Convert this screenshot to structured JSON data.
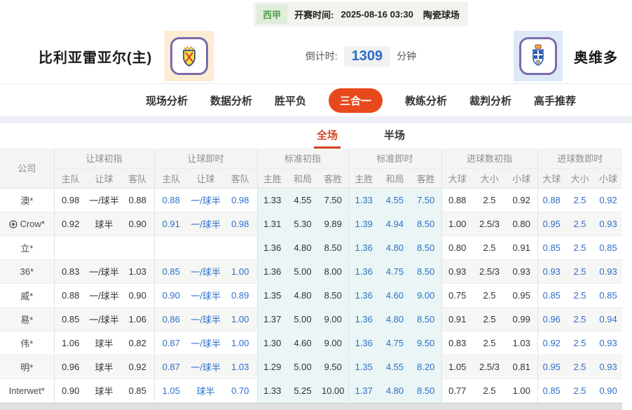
{
  "header": {
    "league": "西甲",
    "kickoff_label": "开赛时间:",
    "kickoff_time": "2025-08-16 03:30",
    "venue": "陶瓷球场",
    "home_team": "比利亚雷亚尔(主)",
    "away_team": "奥维多",
    "countdown_label": "倒计时:",
    "countdown_value": "1309",
    "countdown_unit": "分钟"
  },
  "colors": {
    "accent_red": "#e8491c",
    "tab_red": "#d8472a",
    "live_blue": "#2e6fc9",
    "cyan_column_bg": "#e9f6f5",
    "league_green": "#55a055"
  },
  "nav": {
    "items": [
      {
        "label": "现场分析",
        "active": false
      },
      {
        "label": "数据分析",
        "active": false
      },
      {
        "label": "胜平负",
        "active": false
      },
      {
        "label": "三合一",
        "active": true
      },
      {
        "label": "教练分析",
        "active": false
      },
      {
        "label": "裁判分析",
        "active": false
      },
      {
        "label": "高手推荐",
        "active": false
      }
    ]
  },
  "subtabs": [
    {
      "label": "全场",
      "active": true
    },
    {
      "label": "半场",
      "active": false
    }
  ],
  "table": {
    "company_header": "公司",
    "groups": [
      {
        "label": "让球初指",
        "cols": [
          "主队",
          "让球",
          "客队"
        ]
      },
      {
        "label": "让球即时",
        "cols": [
          "主队",
          "让球",
          "客队"
        ]
      },
      {
        "label": "标准初指",
        "cols": [
          "主胜",
          "和局",
          "客胜"
        ]
      },
      {
        "label": "标准即时",
        "cols": [
          "主胜",
          "和局",
          "客胜"
        ]
      },
      {
        "label": "进球数初指",
        "cols": [
          "大球",
          "大小",
          "小球"
        ]
      },
      {
        "label": "进球数即时",
        "cols": [
          "大球",
          "大小",
          "小球"
        ]
      }
    ],
    "rows": [
      {
        "company": "澳*",
        "icon": false,
        "handicap_initial": [
          "0.98",
          "一/球半",
          "0.88"
        ],
        "handicap_live": [
          "0.88",
          "一/球半",
          "0.98"
        ],
        "standard_initial": [
          "1.33",
          "4.55",
          "7.50"
        ],
        "standard_live": [
          "1.33",
          "4.55",
          "7.50"
        ],
        "goals_initial": [
          "0.88",
          "2.5",
          "0.92"
        ],
        "goals_live": [
          "0.88",
          "2.5",
          "0.92"
        ]
      },
      {
        "company": "Crow*",
        "icon": true,
        "handicap_initial": [
          "0.92",
          "球半",
          "0.90"
        ],
        "handicap_live": [
          "0.91",
          "一/球半",
          "0.98"
        ],
        "standard_initial": [
          "1.31",
          "5.30",
          "9.89"
        ],
        "standard_live": [
          "1.39",
          "4.94",
          "8.50"
        ],
        "goals_initial": [
          "1.00",
          "2.5/3",
          "0.80"
        ],
        "goals_live": [
          "0.95",
          "2.5",
          "0.93"
        ]
      },
      {
        "company": "立*",
        "icon": false,
        "handicap_initial": [
          "",
          "",
          ""
        ],
        "handicap_live": [
          "",
          "",
          ""
        ],
        "standard_initial": [
          "1.36",
          "4.80",
          "8.50"
        ],
        "standard_live": [
          "1.36",
          "4.80",
          "8.50"
        ],
        "goals_initial": [
          "0.80",
          "2.5",
          "0.91"
        ],
        "goals_live": [
          "0.85",
          "2.5",
          "0.85"
        ]
      },
      {
        "company": "36*",
        "icon": false,
        "handicap_initial": [
          "0.83",
          "一/球半",
          "1.03"
        ],
        "handicap_live": [
          "0.85",
          "一/球半",
          "1.00"
        ],
        "standard_initial": [
          "1.36",
          "5.00",
          "8.00"
        ],
        "standard_live": [
          "1.36",
          "4.75",
          "8.50"
        ],
        "goals_initial": [
          "0.93",
          "2.5/3",
          "0.93"
        ],
        "goals_live": [
          "0.93",
          "2.5",
          "0.93"
        ]
      },
      {
        "company": "威*",
        "icon": false,
        "handicap_initial": [
          "0.88",
          "一/球半",
          "0.90"
        ],
        "handicap_live": [
          "0.90",
          "一/球半",
          "0.89"
        ],
        "standard_initial": [
          "1.35",
          "4.80",
          "8.50"
        ],
        "standard_live": [
          "1.36",
          "4.60",
          "9.00"
        ],
        "goals_initial": [
          "0.75",
          "2.5",
          "0.95"
        ],
        "goals_live": [
          "0.85",
          "2.5",
          "0.85"
        ]
      },
      {
        "company": "易*",
        "icon": false,
        "handicap_initial": [
          "0.85",
          "一/球半",
          "1.06"
        ],
        "handicap_live": [
          "0.86",
          "一/球半",
          "1.00"
        ],
        "standard_initial": [
          "1.37",
          "5.00",
          "9.00"
        ],
        "standard_live": [
          "1.36",
          "4.80",
          "8.50"
        ],
        "goals_initial": [
          "0.91",
          "2.5",
          "0.99"
        ],
        "goals_live": [
          "0.96",
          "2.5",
          "0.94"
        ]
      },
      {
        "company": "伟*",
        "icon": false,
        "handicap_initial": [
          "1.06",
          "球半",
          "0.82"
        ],
        "handicap_live": [
          "0.87",
          "一/球半",
          "1.00"
        ],
        "standard_initial": [
          "1.30",
          "4.60",
          "9.00"
        ],
        "standard_live": [
          "1.36",
          "4.75",
          "9.50"
        ],
        "goals_initial": [
          "0.83",
          "2.5",
          "1.03"
        ],
        "goals_live": [
          "0.92",
          "2.5",
          "0.93"
        ]
      },
      {
        "company": "明*",
        "icon": false,
        "handicap_initial": [
          "0.96",
          "球半",
          "0.92"
        ],
        "handicap_live": [
          "0.87",
          "一/球半",
          "1.03"
        ],
        "standard_initial": [
          "1.29",
          "5.00",
          "9.50"
        ],
        "standard_live": [
          "1.35",
          "4.55",
          "8.20"
        ],
        "goals_initial": [
          "1.05",
          "2.5/3",
          "0.81"
        ],
        "goals_live": [
          "0.95",
          "2.5",
          "0.93"
        ]
      },
      {
        "company": "Interwet*",
        "icon": false,
        "handicap_initial": [
          "0.90",
          "球半",
          "0.85"
        ],
        "handicap_live": [
          "1.05",
          "球半",
          "0.70"
        ],
        "standard_initial": [
          "1.33",
          "5.25",
          "10.00"
        ],
        "standard_live": [
          "1.37",
          "4.80",
          "8.50"
        ],
        "goals_initial": [
          "0.77",
          "2.5",
          "1.00"
        ],
        "goals_live": [
          "0.85",
          "2.5",
          "0.90"
        ]
      }
    ]
  }
}
